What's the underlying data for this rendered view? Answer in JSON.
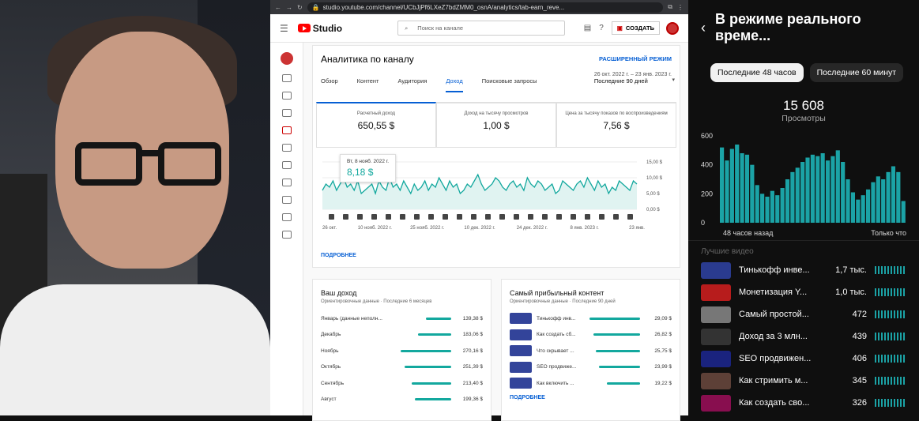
{
  "browser": {
    "url": "studio.youtube.com/channel/UCbJjPf6LXeZ7bdZMM0_osnA/analytics/tab-earn_reve..."
  },
  "studio": {
    "logo": "Studio",
    "search_placeholder": "Поиск на канале",
    "create_label": "СОЗДАТЬ",
    "page_title": "Аналитика по каналу",
    "advanced": "РАСШИРЕННЫЙ РЕЖИМ",
    "tabs": [
      "Обзор",
      "Контент",
      "Аудитория",
      "Доход",
      "Поисковые запросы"
    ],
    "active_tab": 3,
    "period_dates": "26 окт. 2022 г. – 23 янв. 2023 г.",
    "period_label": "Последние 90 дней",
    "metrics": [
      {
        "label": "Расчетный доход",
        "value": "650,55 $"
      },
      {
        "label": "Доход на тысячу просмотров",
        "value": "1,00 $"
      },
      {
        "label": "Цена за тысячу показов по воспроизведениям",
        "value": "7,56 $"
      }
    ],
    "tooltip": {
      "date": "Вт, 8 нояб. 2022 г.",
      "value": "8,18 $"
    },
    "more_label": "ПОДРОБНЕЕ"
  },
  "chart_data": {
    "type": "line",
    "y_ticks": [
      "15,00 $",
      "10,00 $",
      "5,00 $",
      "0,00 $"
    ],
    "x_ticks": [
      "26 окт.",
      "10 нояб. 2022 г.",
      "25 нояб. 2022 г.",
      "10 дек. 2022 г.",
      "24 дек. 2022 г.",
      "8 янв. 2023 г.",
      "23 янв."
    ],
    "values": [
      6,
      8,
      7,
      9,
      6,
      8,
      10,
      7,
      8,
      6,
      9,
      5,
      6,
      7,
      8,
      5,
      9,
      7,
      6,
      10,
      7,
      8,
      6,
      9,
      7,
      5,
      8,
      6,
      7,
      9,
      6,
      8,
      7,
      10,
      8,
      6,
      9,
      7,
      8,
      5,
      6,
      8,
      7,
      9,
      11,
      8,
      6,
      7,
      8,
      10,
      9,
      7,
      6,
      8,
      9,
      7,
      8,
      6,
      10,
      8,
      7,
      9,
      8,
      6,
      7,
      8,
      5,
      6,
      9,
      8,
      7,
      6,
      8,
      9,
      7,
      10,
      8,
      6,
      9,
      7,
      8,
      5,
      7,
      6,
      9,
      8,
      7,
      6,
      9,
      8
    ],
    "ylim": [
      0,
      15
    ]
  },
  "income": {
    "title": "Ваш доход",
    "subtitle": "Ориентировочные данные · Последние 6 месяцев",
    "rows": [
      {
        "label": "Январь (данные неполн...",
        "value": "139,38 $",
        "frac": 0.5
      },
      {
        "label": "Декабрь",
        "value": "183,06 $",
        "frac": 0.66
      },
      {
        "label": "Ноябрь",
        "value": "270,16 $",
        "frac": 1.0
      },
      {
        "label": "Октябрь",
        "value": "251,39 $",
        "frac": 0.92
      },
      {
        "label": "Сентябрь",
        "value": "213,40 $",
        "frac": 0.78
      },
      {
        "label": "Август",
        "value": "199,36 $",
        "frac": 0.72
      }
    ]
  },
  "top": {
    "title": "Самый прибыльный контент",
    "subtitle": "Ориентировочные данные · Последние 90 дней",
    "rows": [
      {
        "label": "Тинькофф инв...",
        "value": "29,09 $",
        "frac": 1.0
      },
      {
        "label": "Как создать сб...",
        "value": "26,82 $",
        "frac": 0.92
      },
      {
        "label": "Что скрывает ...",
        "value": "25,75 $",
        "frac": 0.88
      },
      {
        "label": "SEO продвиже...",
        "value": "23,99 $",
        "frac": 0.82
      },
      {
        "label": "Как включить ...",
        "value": "19,22 $",
        "frac": 0.66
      }
    ]
  },
  "realtime": {
    "title": "В режиме реального време...",
    "chips": [
      "Последние 48 часов",
      "Последние 60 минут"
    ],
    "views": "15 608",
    "views_label": "Просмотры",
    "y_ticks": [
      "600",
      "400",
      "200",
      "0"
    ],
    "x_left": "48 часов назад",
    "x_right": "Только что",
    "bars": [
      520,
      430,
      510,
      540,
      480,
      470,
      400,
      260,
      200,
      180,
      220,
      190,
      240,
      300,
      350,
      380,
      420,
      450,
      470,
      460,
      480,
      430,
      460,
      500,
      420,
      300,
      210,
      160,
      190,
      230,
      280,
      320,
      300,
      350,
      390,
      350,
      150
    ],
    "section": "Лучшие видео",
    "videos": [
      {
        "title": "Тинькофф инве...",
        "count": "1,7 тыс.",
        "color": "#2a3b8f"
      },
      {
        "title": "Монетизация Y...",
        "count": "1,0 тыс.",
        "color": "#b71c1c"
      },
      {
        "title": "Самый простой...",
        "count": "472",
        "color": "#777"
      },
      {
        "title": "Доход за 3 млн...",
        "count": "439",
        "color": "#333"
      },
      {
        "title": "SEO продвижен...",
        "count": "406",
        "color": "#1a237e"
      },
      {
        "title": "Как стримить м...",
        "count": "345",
        "color": "#5d4037"
      },
      {
        "title": "Как создать сво...",
        "count": "326",
        "color": "#880e4f"
      }
    ]
  }
}
